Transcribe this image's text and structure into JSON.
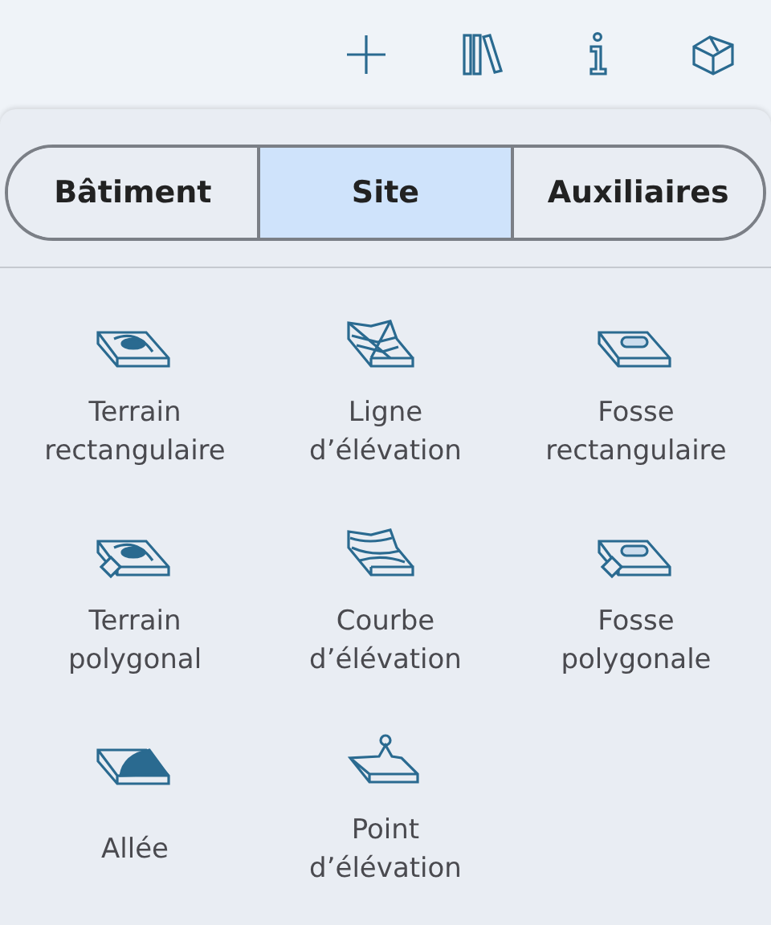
{
  "toolbar": {
    "buttons": [
      {
        "kind": "add"
      },
      {
        "kind": "library"
      },
      {
        "kind": "info"
      },
      {
        "kind": "box"
      }
    ]
  },
  "segments": [
    {
      "label": "Bâtiment",
      "selected": false
    },
    {
      "label": "Site",
      "selected": true
    },
    {
      "label": "Auxiliaires",
      "selected": false
    }
  ],
  "tools": [
    {
      "kind": "terrain-rect",
      "label": "Terrain\nrectangulaire"
    },
    {
      "kind": "line",
      "label": "Ligne\nd’élévation"
    },
    {
      "kind": "pit-rect",
      "label": "Fosse\nrectangulaire"
    },
    {
      "kind": "terrain-poly",
      "label": "Terrain\npolygonal"
    },
    {
      "kind": "curve",
      "label": "Courbe\nd’élévation"
    },
    {
      "kind": "pit-poly",
      "label": "Fosse\npolygonale"
    },
    {
      "kind": "path",
      "label": "Allée"
    },
    {
      "kind": "point",
      "label": "Point\nd’élévation"
    }
  ]
}
